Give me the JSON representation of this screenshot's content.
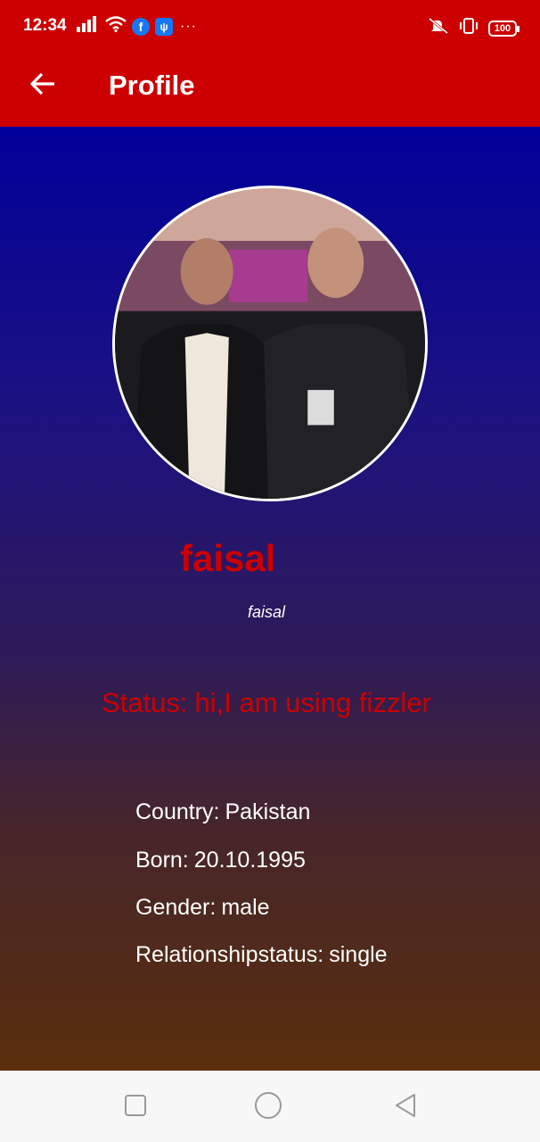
{
  "status_bar": {
    "time": "12:34",
    "battery": "100",
    "icons": [
      "signal-icon",
      "wifi-icon",
      "facebook-icon",
      "usb-icon",
      "more-dots-icon",
      "mute-vibrate-icon",
      "vibrate-icon",
      "battery-icon"
    ]
  },
  "app_bar": {
    "title": "Profile",
    "back_icon": "arrow-left-icon",
    "background": "#cc0000"
  },
  "profile": {
    "name": "faisal",
    "username": "faisal",
    "status_label": "Status:",
    "status_value": "hi,I am using fizzler",
    "accent": "#cc0000"
  },
  "details": {
    "country_label": "Country:",
    "country_value": "Pakistan",
    "born_label": "Born:",
    "born_value": "20.10.1995",
    "gender_label": "Gender:",
    "gender_value": "male",
    "relationship_label": "Relationshipstatus:",
    "relationship_value": "single"
  },
  "nav_bar": {
    "icons": [
      "recent-apps-icon",
      "home-icon",
      "back-triangle-icon"
    ]
  }
}
